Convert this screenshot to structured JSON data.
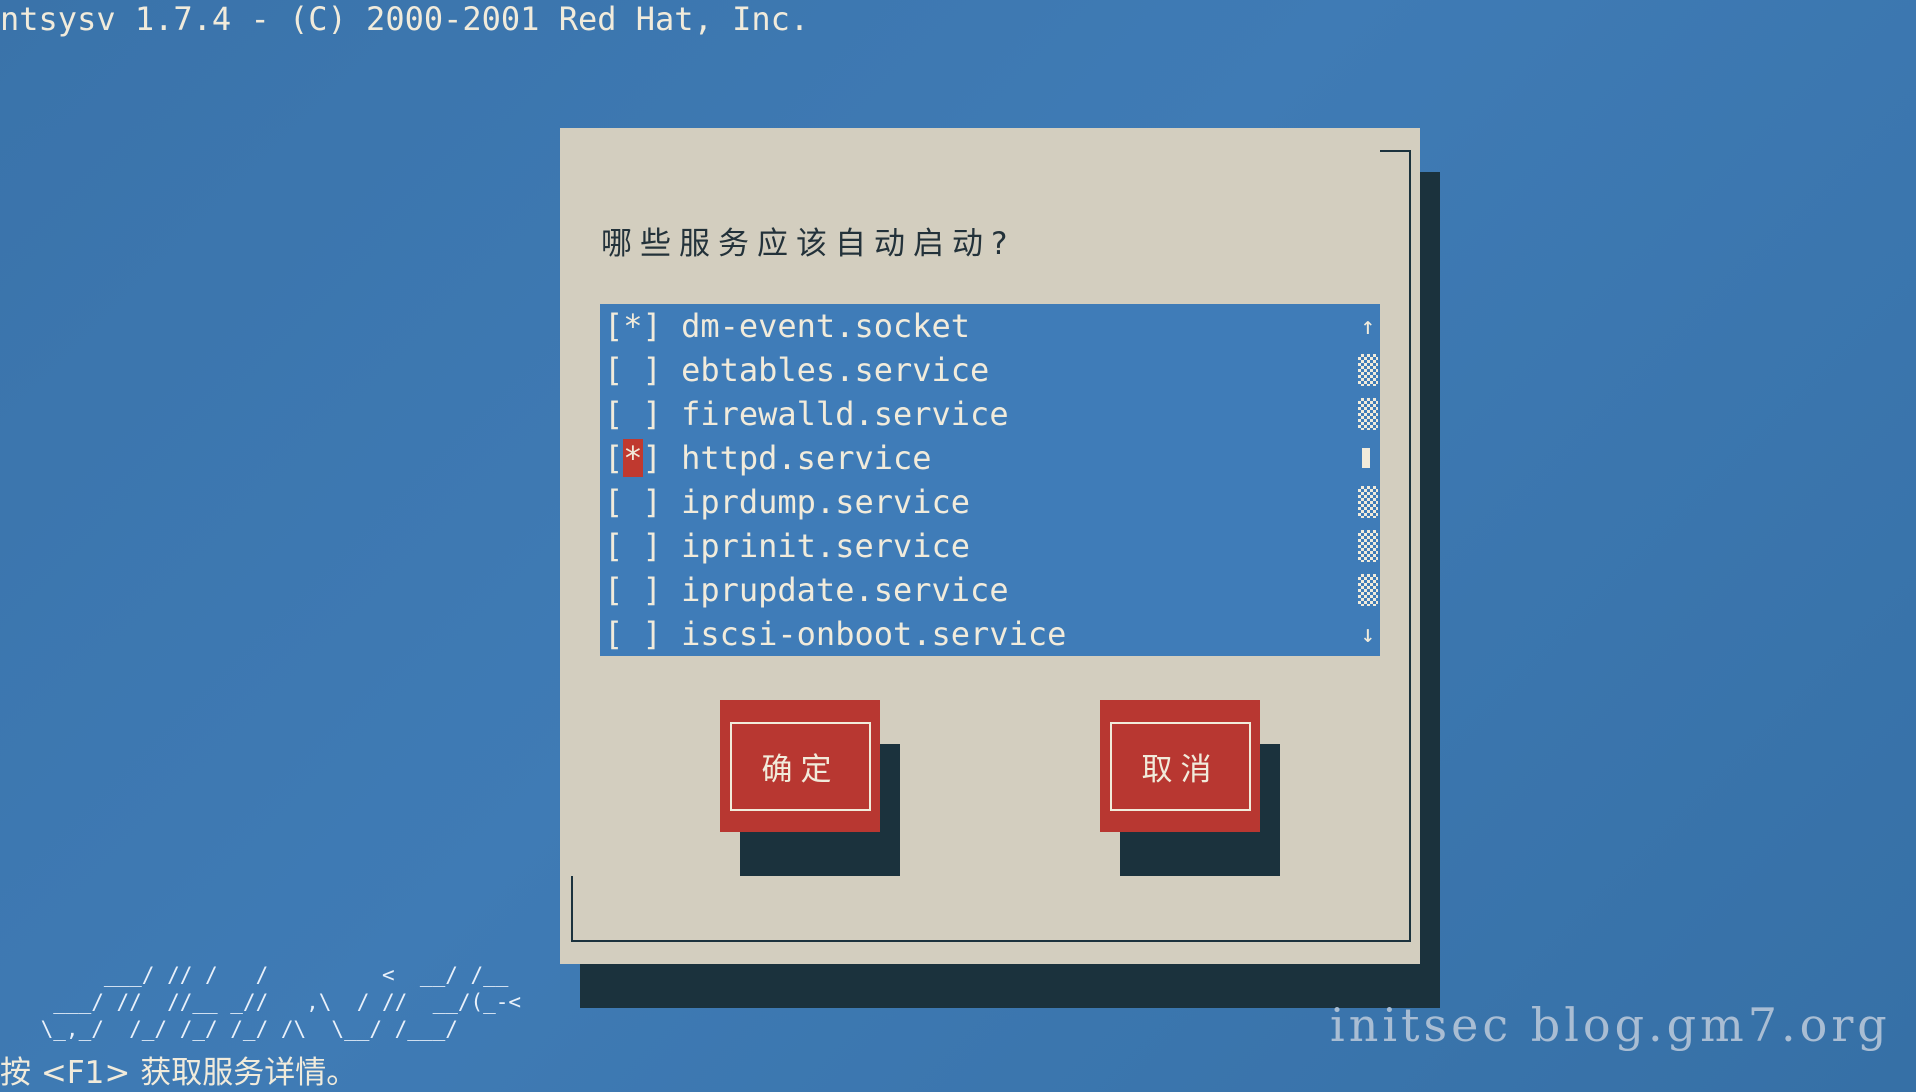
{
  "header": {
    "title": "ntsysv 1.7.4 - (C) 2000-2001 Red Hat, Inc."
  },
  "dialog": {
    "question": "哪些服务应该自动启动?",
    "services": [
      {
        "mark": "[*]",
        "name": "dm-event.socket",
        "checked": true
      },
      {
        "mark": "[ ]",
        "name": "ebtables.service",
        "checked": false
      },
      {
        "mark": "[ ]",
        "name": "firewalld.service",
        "checked": false
      },
      {
        "mark": "[*]",
        "name": "httpd.service",
        "checked": true,
        "focused": true
      },
      {
        "mark": "[ ]",
        "name": "iprdump.service",
        "checked": false
      },
      {
        "mark": "[ ]",
        "name": "iprinit.service",
        "checked": false
      },
      {
        "mark": "[ ]",
        "name": "iprupdate.service",
        "checked": false
      },
      {
        "mark": "[ ]",
        "name": "iscsi-onboot.service",
        "checked": false
      }
    ],
    "scrollbar": {
      "up": "↑",
      "down": "↓",
      "position_row": 4
    },
    "ok_label": "确定",
    "cancel_label": "取消"
  },
  "footer": {
    "hint": "按 <F1> 获取服务详情。",
    "ascii_logo": [
      "      ___/ // /   /         <  __/ /__",
      "  ___/ //  //__ _//   ,\\  / //  __/(_-<",
      " \\_,_/  /_/ /_/ /_/ /\\  \\__/ /___/   "
    ],
    "watermark": "initsec blog.gm7.org"
  },
  "colors": {
    "background": "#3b74aa",
    "dialog": "#d3cebf",
    "list": "#3f7cb8",
    "button": "#b83731",
    "shadow": "#1b323d"
  }
}
